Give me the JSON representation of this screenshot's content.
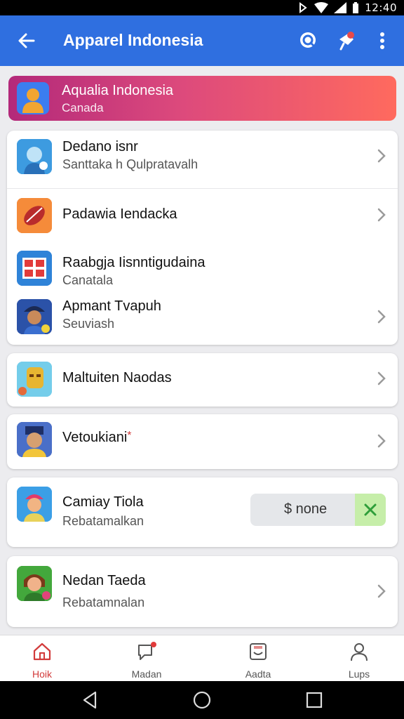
{
  "status_bar": {
    "time": "12:40"
  },
  "app_bar": {
    "title": "Apparel Indonesia",
    "back_icon": "arrow-left-icon",
    "actions": [
      "search-icon",
      "pin-icon",
      "more-vert-icon"
    ],
    "color": "#2f6fe0"
  },
  "banner": {
    "title": "Aqualia Indonesia",
    "subtitle": "Canada"
  },
  "card1": {
    "rows": [
      {
        "title": "Dedano isnr",
        "subtitle": "Santtaka h Qulpratavalh"
      },
      {
        "title": "Padawia Iendacka",
        "subtitle": ""
      },
      {
        "title": "Raabgja Iisnntigudaina",
        "subtitle": "Canatala"
      },
      {
        "title": "Apmant Tvapuh",
        "subtitle": "Seuviash"
      }
    ]
  },
  "card2": {
    "title": "Maltuiten Naodas"
  },
  "card3": {
    "title": "Vetoukiani",
    "marker": "*"
  },
  "card4": {
    "title": "Camiay Tiola",
    "subtitle": "Rebatamalkan",
    "price": "$ none"
  },
  "card5": {
    "title": "Nedan Taeda",
    "subtitle": "Rebatamnalan"
  },
  "bottom_nav": {
    "items": [
      {
        "label": "Hoik",
        "icon": "home-icon",
        "active": true
      },
      {
        "label": "Madan",
        "icon": "chat-icon",
        "active": false
      },
      {
        "label": "Aadta",
        "icon": "inbox-icon",
        "active": false
      },
      {
        "label": "Lups",
        "icon": "person-icon",
        "active": false
      }
    ],
    "active_color": "#d23a3a"
  },
  "system_nav": [
    "back-triangle-icon",
    "home-circle-icon",
    "recents-square-icon"
  ]
}
